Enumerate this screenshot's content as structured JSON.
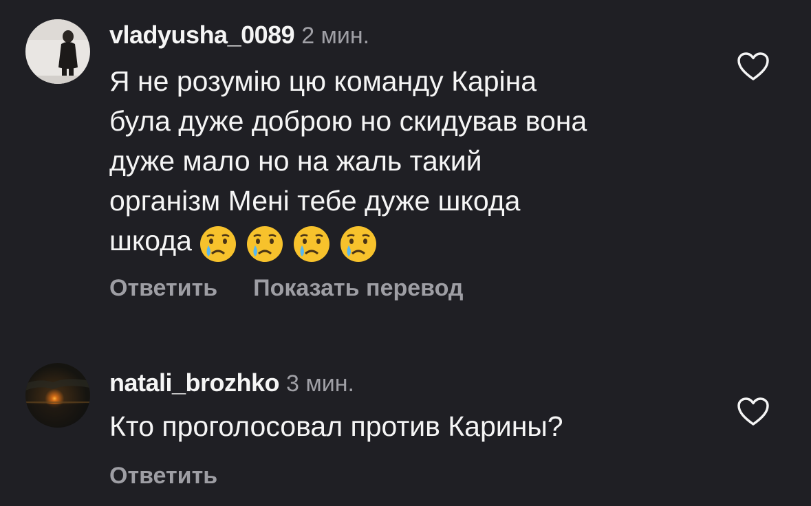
{
  "comments": [
    {
      "username": "vladyusha_0089",
      "time": "2 мин.",
      "lines": [
        "Я не розумію цю команду Каріна",
        "була дуже доброю но скидував вона",
        "дуже мало но на жаль такий",
        "організм Мені тебе дуже шкода",
        "шкода"
      ],
      "emoji_count": 4,
      "emoji": "crying-face",
      "reply_label": "Ответить",
      "translate_label": "Показать перевод"
    },
    {
      "username": "natali_brozhko",
      "time": "3 мин.",
      "lines": [
        "Кто проголосовал против Карины?"
      ],
      "reply_label": "Ответить"
    }
  ],
  "colors": {
    "background": "#1f1f24",
    "primary_text": "#f5f5f5",
    "secondary_text": "#a0a0a6",
    "action_text": "#9e9ea4"
  }
}
